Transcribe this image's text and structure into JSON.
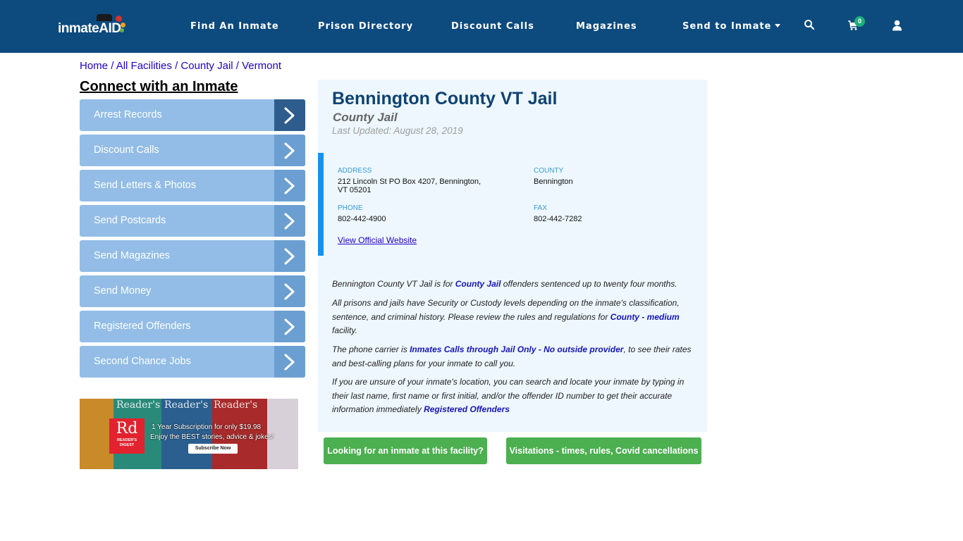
{
  "header": {
    "logo_text": "inmateAID",
    "nav": [
      {
        "label": "Find An Inmate"
      },
      {
        "label": "Prison Directory"
      },
      {
        "label": "Discount Calls"
      },
      {
        "label": "Magazines"
      },
      {
        "label": "Send to Inmate",
        "has_dropdown": true
      }
    ],
    "icons": [
      "search-icon",
      "cart-icon",
      "user-icon"
    ],
    "cart_count": "0"
  },
  "breadcrumb": [
    {
      "label": "Home"
    },
    {
      "label": "All Facilities"
    },
    {
      "label": "County Jail"
    },
    {
      "label": "Vermont"
    }
  ],
  "breadcrumb_separator": "/",
  "sidebar": {
    "title": "Connect with an Inmate",
    "items": [
      {
        "label": "Arrest Records",
        "active": true
      },
      {
        "label": "Discount Calls"
      },
      {
        "label": "Send Letters & Photos"
      },
      {
        "label": "Send Postcards"
      },
      {
        "label": "Send Magazines"
      },
      {
        "label": "Send Money"
      },
      {
        "label": "Registered Offenders"
      },
      {
        "label": "Second Chance Jobs"
      }
    ]
  },
  "ad": {
    "brand_short": "Rd",
    "brand_name_line1": "READER'S",
    "brand_name_line2": "DIGEST",
    "masthead": "Reader's",
    "headline": "1 Year Subscription for only $19.98",
    "tagline": "Enjoy the BEST stories, advice & jokes!",
    "cta": "Subscribe Now"
  },
  "facility": {
    "name": "Bennington County VT Jail",
    "type": "County Jail",
    "last_updated": "Last Updated: August 28, 2019",
    "address_label": "ADDRESS",
    "address_line1": "212 Lincoln St PO Box 4207, Bennington,",
    "address_line2": "VT 05201",
    "county_label": "COUNTY",
    "county": "Bennington",
    "phone_label": "PHONE",
    "phone": "802-442-4900",
    "fax_label": "FAX",
    "fax": "802-442-7282",
    "website_link": "View Official Website"
  },
  "description": {
    "p1_pre": "Bennington County VT Jail is for ",
    "p1_link": "County Jail",
    "p1_post": " offenders sentenced up to twenty four months.",
    "p2_pre": "All prisons and jails have Security or Custody levels depending on the inmate's classification, sentence, and criminal history. Please review the rules and regulations for ",
    "p2_link": "County - medium",
    "p2_post": " facility.",
    "p3_pre": "The phone carrier is ",
    "p3_link": "Inmates Calls through Jail Only - No outside provider",
    "p3_post": ", to see their rates and best-calling plans for your inmate to call you.",
    "p4_pre": "If you are unsure of your inmate's location, you can search and locate your inmate by typing in their last name, first name or first initial, and/or the offender ID number to get their accurate information immediately ",
    "p4_link": "Registered Offenders"
  },
  "buttons": {
    "find_inmate": "Looking for an inmate at this facility?",
    "visitations": "Visitations - times, rules, Covid cancellations"
  },
  "colors": {
    "header_bg": "#0d4a7e",
    "sidebar_item": "#93bde6",
    "sidebar_arrow": "#6b9fd2",
    "sidebar_arrow_active": "#2e5d8d",
    "card_bg": "#edf7fd",
    "title": "#0e4272",
    "accent_bar": "#1592ee",
    "green_button": "#4caf50",
    "badge": "#1fae7a"
  }
}
